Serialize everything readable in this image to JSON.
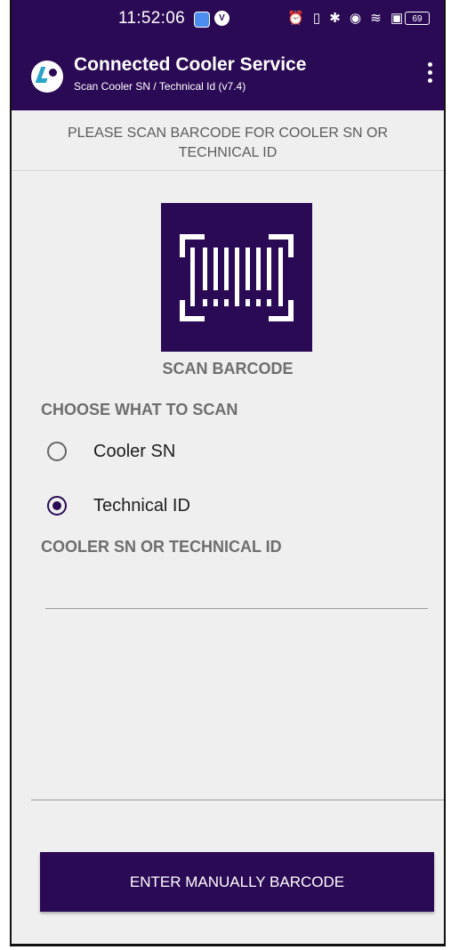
{
  "status_bar": {
    "time": "11:52:06",
    "status_icons": "⏰ ▯ ✱ ◉ ≋ ▣",
    "battery": "69"
  },
  "app_bar": {
    "title": "Connected Cooler Service",
    "subtitle": "Scan Cooler SN / Technical Id (v7.4)",
    "menu_icon": "more-vertical-icon"
  },
  "banner": {
    "text": "PLEASE SCAN BARCODE FOR COOLER SN OR TECHNICAL ID"
  },
  "scan": {
    "label": "SCAN BARCODE",
    "icon": "barcode-scan-icon"
  },
  "choose": {
    "heading": "CHOOSE WHAT TO SCAN",
    "options": [
      {
        "label": "Cooler SN",
        "selected": false
      },
      {
        "label": "Technical ID",
        "selected": true
      }
    ]
  },
  "field": {
    "label": "COOLER SN OR TECHNICAL ID",
    "value": ""
  },
  "button": {
    "label": "ENTER MANUALLY BARCODE"
  },
  "colors": {
    "brand": "#2b0a55",
    "accent": "#2aa4c9",
    "background": "#efefef"
  }
}
